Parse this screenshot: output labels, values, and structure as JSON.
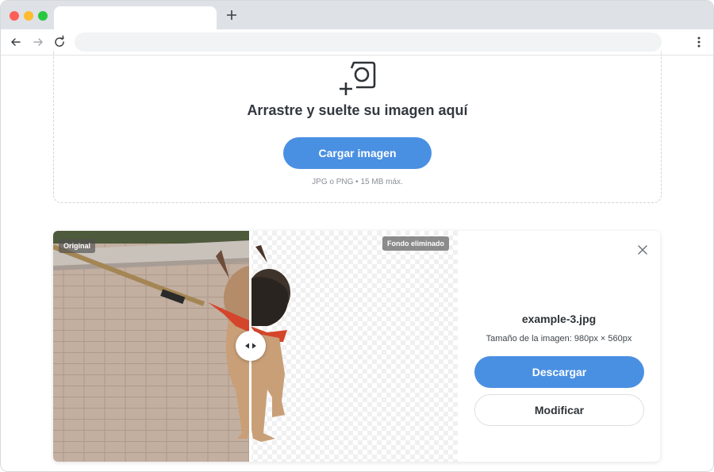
{
  "browser": {
    "tab_title": "",
    "new_tab_icon": "plus-icon",
    "url": ""
  },
  "upload": {
    "title": "Arrastre y suelte su imagen aquí",
    "button_label": "Cargar imagen",
    "hint": "JPG o PNG • 15 MB máx.",
    "icon": "add-photo-icon"
  },
  "result": {
    "original_badge": "Original",
    "removed_badge": "Fondo eliminado",
    "filename": "example-3.jpg",
    "size_text": "Tamaño de la imagen: 980px × 560px",
    "download_label": "Descargar",
    "modify_label": "Modificar",
    "close_icon": "close-icon"
  },
  "colors": {
    "accent": "#4a90e2",
    "tabbar": "#dee1e6"
  }
}
